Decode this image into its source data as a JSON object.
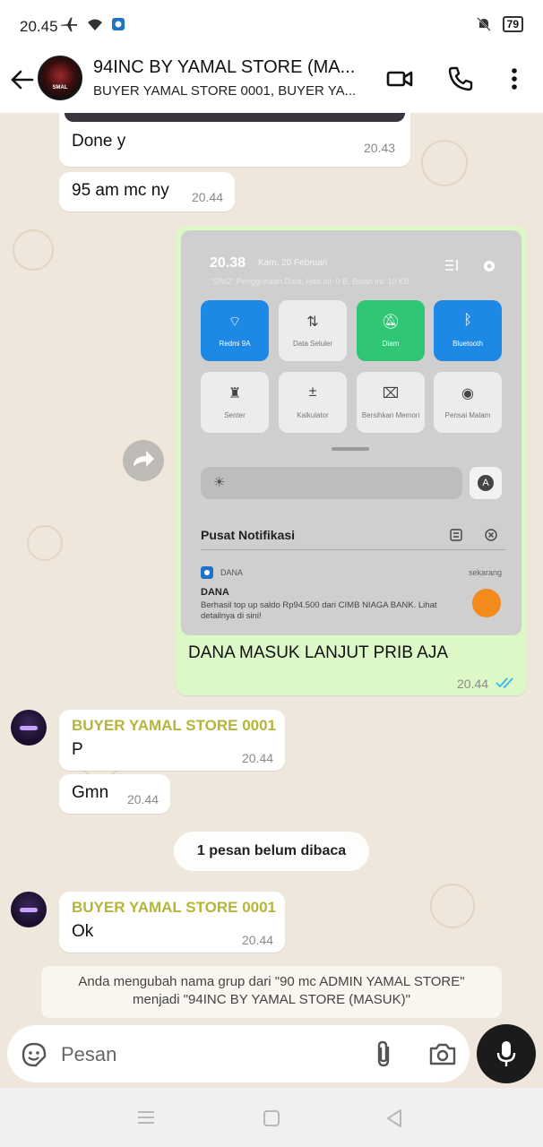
{
  "status_bar": {
    "time": "20.45",
    "battery": "79"
  },
  "header": {
    "avatar_text": "SMAL",
    "title": "94INC BY YAMAL STORE (MA...",
    "subtitle": "BUYER YAMAL STORE 0001, BUYER YA..."
  },
  "messages": [
    {
      "text": "Done y",
      "time": "20.43"
    },
    {
      "text": "95 am mc ny",
      "time": "20.44"
    },
    {
      "text": "DANA MASUK LANJUT PRIB AJA",
      "time": "20.44",
      "screenshot": {
        "time": "20.38",
        "date": "Kam, 20 Februari",
        "usage": "\"SIM2\" Penggunaan Data, Hari ini: 0 B, Bulan ini: 10 KB",
        "tiles": [
          "Redmi 9A",
          "Data Seluler",
          "Diam",
          "Bluetooth",
          "Senter",
          "Kalkulator",
          "Bersihkan Memori",
          "Pensai Malam"
        ],
        "auto_label": "A",
        "notif_center": "Pusat Notifikasi",
        "notif_app": "DANA",
        "notif_time": "sekarang",
        "notif_title": "DANA",
        "notif_body": "Berhasil top up saldo Rp94.500 dari CIMB NIAGA BANK. Lihat detailnya di sini!"
      }
    },
    {
      "sender": "BUYER YAMAL STORE 0001",
      "text": "P",
      "time": "20.44"
    },
    {
      "text": "Gmn",
      "time": "20.44"
    },
    {
      "sender": "BUYER YAMAL STORE 0001",
      "text": "Ok",
      "time": "20.44"
    }
  ],
  "unread_label": "1 pesan belum dibaca",
  "system_message": {
    "line1": "Anda mengubah nama grup dari \"90 mc ADMIN YAMAL STORE\"",
    "line2": "menjadi \"94INC BY YAMAL STORE (MASUK)\""
  },
  "input": {
    "placeholder": "Pesan"
  },
  "colors": {
    "outgoing": "#dcf8c6",
    "sender_name": "#b4b53a",
    "read_ticks": "#34b7f1"
  }
}
